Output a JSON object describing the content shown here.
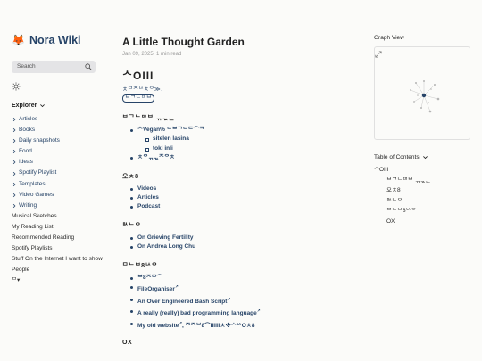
{
  "site": {
    "name": "Nora Wiki",
    "logo_icon": "fox-icon"
  },
  "search": {
    "placeholder": "Search"
  },
  "explorer": {
    "title": "Explorer",
    "folders": [
      "Articles",
      "Books",
      "Daily snapshots",
      "Food",
      "Ideas",
      "Spotify Playlist",
      "Templates",
      "Video Games",
      "Writing"
    ],
    "files": [
      "Musical Sketches",
      "My Reading List",
      "Recommended Reading",
      "Spotify Playlists",
      "Stuff On the Internet I want to show",
      "People",
      "ᄆ▾"
    ]
  },
  "page": {
    "title": "A Little Thought Garden",
    "meta": "Jan 09, 2025, 1 min read",
    "heading": "ᄉOIII",
    "intro_line1": "ㅊᄆᄌᄂᄉㅊᄋ≫↓",
    "intro_line2": "ᄇᄀᄂᄃᄆᄇ",
    "sections": [
      {
        "heading": "ᄇᄀᄂᄃᄆᄇ ᆩᆪᆫ",
        "items": [
          {
            "text": "ᄉVegan% ᄂᄇᄀᄂᄃ⌒ᄏ",
            "level": 1
          },
          {
            "text": "sitelen lasina",
            "level": 2
          },
          {
            "text": "toki inli",
            "level": 2
          },
          {
            "text": "ㅊᄋᆩᆪᄌᄋㅊ",
            "level": 1
          }
        ]
      },
      {
        "heading": "오ㅊ8",
        "items": [
          {
            "text": "Videos",
            "level": 1
          },
          {
            "text": "Articles",
            "level": 1
          },
          {
            "text": "Podcast",
            "level": 1
          }
        ]
      },
      {
        "heading": "ᄆᄉᄂᄋ",
        "items": [
          {
            "text": "On Grieving Fertility",
            "level": 1
          },
          {
            "text": "On Andrea Long Chu",
            "level": 1
          }
        ]
      },
      {
        "heading": "ᄆᄂᄇ8ᄂᄉᄋ",
        "items": [
          {
            "text": "ᄇ8ᄌᄆ⌒",
            "level": 1
          },
          {
            "text": "FileOrganiser",
            "level": 1,
            "external": true
          },
          {
            "text": "An Over Engineered Bash Script",
            "level": 1,
            "external": true
          },
          {
            "text": "A really (really) bad programming language",
            "level": 1,
            "external": true
          },
          {
            "text": "My old website",
            "level": 1,
            "external": true,
            "suffix": ", ᄌᄌᄇ8⌒IIIIIIㅊ※ᄉᄂᄉOㅊ8"
          }
        ]
      }
    ],
    "next_heading": "OX"
  },
  "graph": {
    "title": "Graph View",
    "expand_icon": "expand-icon"
  },
  "toc": {
    "title": "Table of Contents",
    "items": [
      {
        "text": "ᄉOIII",
        "level": 1
      },
      {
        "text": "ᄇᄀᄂᄃᄆᄇ ᆩᆪᆫ",
        "level": 2
      },
      {
        "text": "오ㅊ8",
        "level": 2
      },
      {
        "text": "ᄆᄉᄂᄋ",
        "level": 2
      },
      {
        "text": "ᄆᄂᄇ8ᄂᄉᄋ",
        "level": 2
      },
      {
        "text": "OX",
        "level": 2
      }
    ]
  },
  "colors": {
    "link": "#274468",
    "accent": "#e07a2a",
    "background": "#fbfbf9"
  }
}
